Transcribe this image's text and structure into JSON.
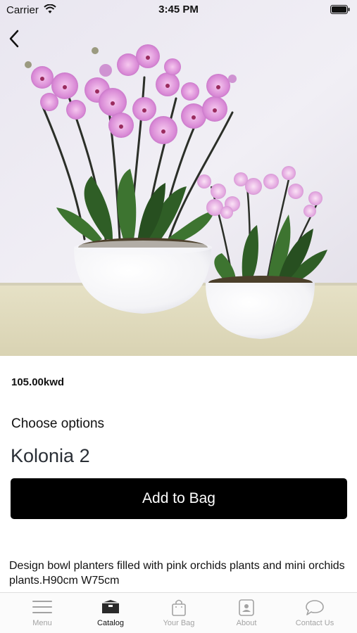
{
  "status_bar": {
    "carrier": "Carrier",
    "time": "3:45 PM"
  },
  "product": {
    "image_icon": "orchid-bowls-photo",
    "price": "105.00kwd",
    "options_label": "Choose options",
    "selected_option": "Kolonia 2",
    "add_button_label": "Add to Bag",
    "description": "Design bowl planters filled with  pink orchids plants and mini orchids plants.H90cm W75cm"
  },
  "tab_bar": {
    "active_color": "#111111",
    "inactive_color": "#a3a3a3",
    "tabs": [
      {
        "label": "Menu",
        "icon": "hamburger-icon"
      },
      {
        "label": "Catalog",
        "icon": "box-icon"
      },
      {
        "label": "Your Bag",
        "icon": "shopping-bag-icon"
      },
      {
        "label": "About",
        "icon": "profile-card-icon"
      },
      {
        "label": "Contact Us",
        "icon": "speech-bubble-icon"
      }
    ]
  }
}
